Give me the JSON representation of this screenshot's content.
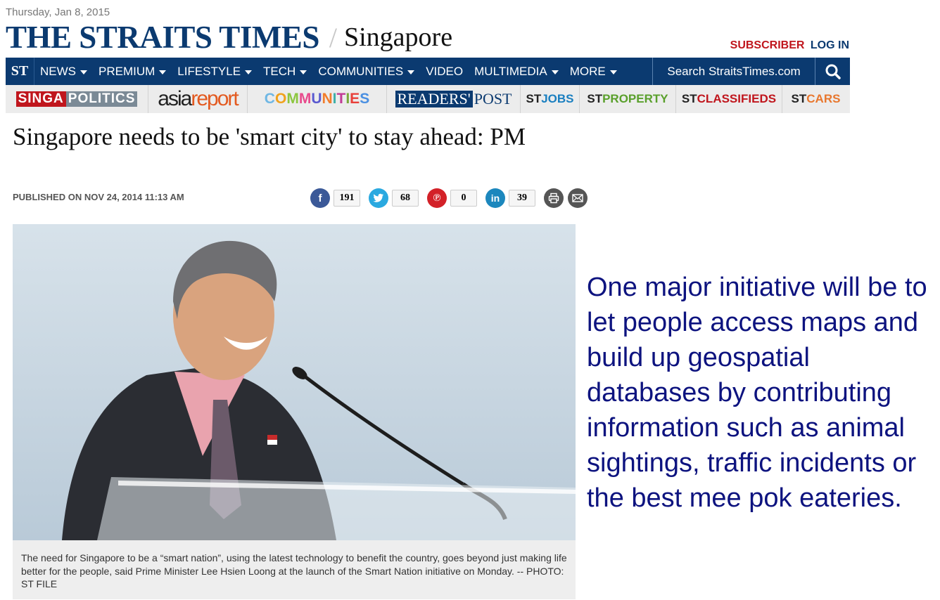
{
  "header": {
    "date": "Thursday, Jan 8, 2015",
    "masthead_title": "THE STRAITS TIMES",
    "masthead_slash": "/",
    "section": "Singapore",
    "subscriber": "SUBSCRIBER",
    "login": "LOG IN"
  },
  "nav": {
    "logo": "ST",
    "items": [
      {
        "label": "NEWS",
        "dropdown": true
      },
      {
        "label": "PREMIUM",
        "dropdown": true
      },
      {
        "label": "LIFESTYLE",
        "dropdown": true
      },
      {
        "label": "TECH",
        "dropdown": true
      },
      {
        "label": "COMMUNITIES",
        "dropdown": true
      },
      {
        "label": "VIDEO",
        "dropdown": false
      },
      {
        "label": "MULTIMEDIA",
        "dropdown": true
      },
      {
        "label": "MORE",
        "dropdown": true
      }
    ],
    "search_placeholder": "Search StraitsTimes.com"
  },
  "subnav": {
    "singa_a": "SINGA",
    "singa_b": "POLITICS",
    "asia_a": "asia",
    "asia_b": "report",
    "communities": "COMMUNITIES",
    "readers_a": "READERS'",
    "readers_b": "POST",
    "st_links": [
      {
        "pre": "ST",
        "post": "JOBS",
        "color": "#1a7fc0"
      },
      {
        "pre": "ST",
        "post": "PROPERTY",
        "color": "#5aa02c"
      },
      {
        "pre": "ST",
        "post": "CLASSIFIEDS",
        "color": "#c0161d"
      },
      {
        "pre": "ST",
        "post": "CARS",
        "color": "#e8772e"
      }
    ]
  },
  "article": {
    "title": "Singapore needs to be 'smart city' to stay ahead: PM",
    "published": "PUBLISHED ON NOV 24, 2014 11:13 AM",
    "share": {
      "facebook": "191",
      "twitter": "68",
      "pinterest": "0",
      "linkedin": "39"
    },
    "caption": "The need for Singapore to be a “smart nation”, using the latest technology to benefit the country, goes beyond just making life better for the people, said Prime Minister Lee Hsien Loong at the launch of the Smart Nation initiative on Monday. -- PHOTO: ST FILE"
  },
  "pull_quote": "One major initiative will be to let people access maps and build up geospatial databases by contributing information such as animal sightings, traffic incidents or the best mee pok eateries.",
  "colors": {
    "brand_navy": "#0b3a70",
    "subscriber_red": "#c0161d",
    "quote_blue": "#0d137f"
  }
}
